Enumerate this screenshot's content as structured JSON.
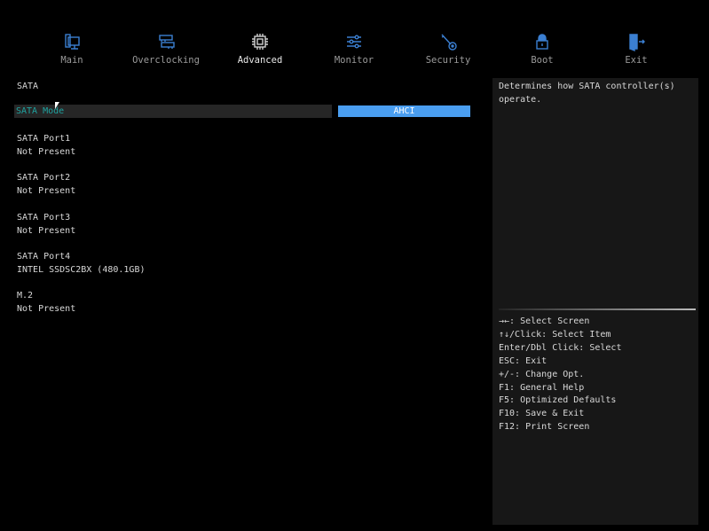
{
  "colors": {
    "accent": "#4a9ef0",
    "icon": "#3b7fd1",
    "selected_label": "#1fa3a0",
    "panel": "#171717"
  },
  "tabs": [
    {
      "label": "Main",
      "icon": "monitor-icon"
    },
    {
      "label": "Overclocking",
      "icon": "memory-icon"
    },
    {
      "label": "Advanced",
      "icon": "cpu-chip-icon",
      "active": true
    },
    {
      "label": "Monitor",
      "icon": "sliders-icon"
    },
    {
      "label": "Security",
      "icon": "key-icon"
    },
    {
      "label": "Boot",
      "icon": "lock-icon"
    },
    {
      "label": "Exit",
      "icon": "exit-door-icon"
    }
  ],
  "section_title": "SATA",
  "sata_mode": {
    "label": "SATA Mode",
    "value": "AHCI"
  },
  "ports": [
    {
      "name": "SATA Port1",
      "status": "Not Present"
    },
    {
      "name": "SATA Port2",
      "status": "Not Present"
    },
    {
      "name": "SATA Port3",
      "status": "Not Present"
    },
    {
      "name": "SATA Port4",
      "status": "INTEL SSDSC2BX (480.1GB)"
    },
    {
      "name": "M.2",
      "status": "Not Present"
    }
  ],
  "help": {
    "description": "Determines how SATA controller(s)\noperate.",
    "keys": [
      "→←: Select Screen",
      "↑↓/Click: Select Item",
      "Enter/Dbl Click: Select",
      "ESC: Exit",
      "+/-: Change Opt.",
      "F1: General Help",
      "F5: Optimized Defaults",
      "F10: Save & Exit",
      "F12: Print Screen"
    ]
  }
}
